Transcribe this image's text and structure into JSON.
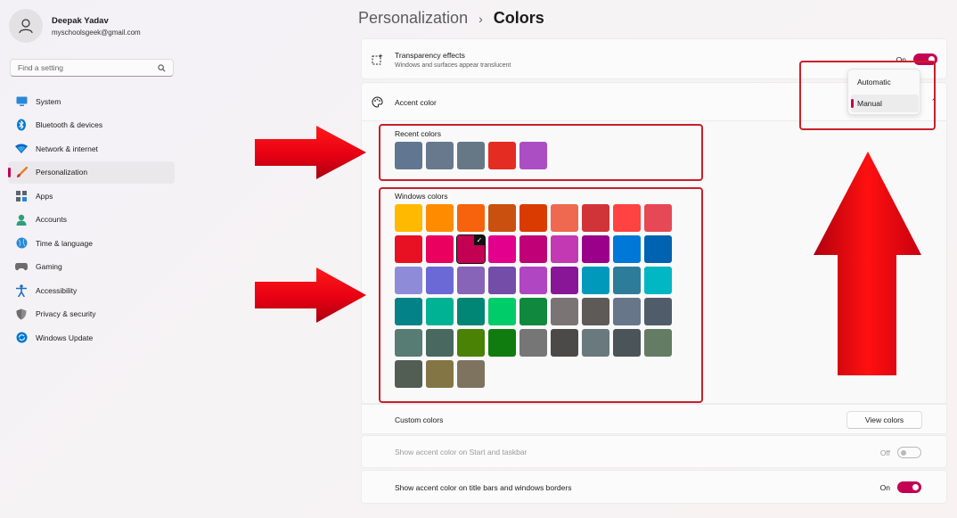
{
  "profile": {
    "name": "Deepak Yadav",
    "email": "myschoolsgeek@gmail.com"
  },
  "search": {
    "placeholder": "Find a setting"
  },
  "sidebar": {
    "items": [
      {
        "label": "System",
        "icon": "monitor-icon",
        "color": "#2b88d8",
        "active": false
      },
      {
        "label": "Bluetooth & devices",
        "icon": "bluetooth-icon",
        "color": "#0078d4",
        "active": false
      },
      {
        "label": "Network & internet",
        "icon": "wifi-icon",
        "color": "#0067c0",
        "active": false
      },
      {
        "label": "Personalization",
        "icon": "brush-icon",
        "color": "#e67e22",
        "active": true
      },
      {
        "label": "Apps",
        "icon": "apps-icon",
        "color": "#5a6570",
        "active": false
      },
      {
        "label": "Accounts",
        "icon": "person-icon",
        "color": "#2e9f79",
        "active": false
      },
      {
        "label": "Time & language",
        "icon": "globe-icon",
        "color": "#2b88d8",
        "active": false
      },
      {
        "label": "Gaming",
        "icon": "gamepad-icon",
        "color": "#6c6c6c",
        "active": false
      },
      {
        "label": "Accessibility",
        "icon": "accessibility-icon",
        "color": "#1f6fc0",
        "active": false
      },
      {
        "label": "Privacy & security",
        "icon": "shield-icon",
        "color": "#6d6d6d",
        "active": false
      },
      {
        "label": "Windows Update",
        "icon": "update-icon",
        "color": "#0078d4",
        "active": false
      }
    ]
  },
  "header": {
    "parent": "Personalization",
    "separator": "›",
    "current": "Colors"
  },
  "transparency": {
    "title": "Transparency effects",
    "subtitle": "Windows and surfaces appear translucent",
    "state": "On"
  },
  "accent": {
    "title": "Accent color",
    "mode_options": [
      "Automatic",
      "Manual"
    ],
    "selected_mode": "Manual"
  },
  "recent_colors": {
    "label": "Recent colors",
    "colors": [
      "#617691",
      "#68788d",
      "#667886",
      "#e42c22",
      "#ab4ec3"
    ]
  },
  "windows_colors": {
    "label": "Windows colors",
    "selected_index": 11,
    "colors": [
      "#ffb900",
      "#ff8c00",
      "#f7630c",
      "#ca5010",
      "#da3b01",
      "#ef6950",
      "#d13438",
      "#ff4343",
      "#e74856",
      "#e81123",
      "#ea005e",
      "#c30052",
      "#e3008c",
      "#bf0077",
      "#c239b3",
      "#9a0089",
      "#0078d7",
      "#0063b1",
      "#8e8cd8",
      "#6b69d6",
      "#8764b8",
      "#744da9",
      "#b146c2",
      "#881798",
      "#0099bc",
      "#2d7d9a",
      "#00b7c3",
      "#038387",
      "#00b294",
      "#018574",
      "#00cc6a",
      "#10893e",
      "#7a7574",
      "#5d5a58",
      "#68768a",
      "#515c6b",
      "#567c73",
      "#486860",
      "#498205",
      "#107c10",
      "#767676",
      "#4c4a48",
      "#69797e",
      "#4a5459",
      "#647c64",
      "#525e54",
      "#847545",
      "#7e735f"
    ]
  },
  "custom_colors": {
    "label": "Custom colors",
    "button": "View colors"
  },
  "start_taskbar": {
    "label": "Show accent color on Start and taskbar",
    "state": "Off"
  },
  "title_bars": {
    "label": "Show accent color on title bars and windows borders",
    "state": "On"
  },
  "annotation_color": "#e0001a"
}
